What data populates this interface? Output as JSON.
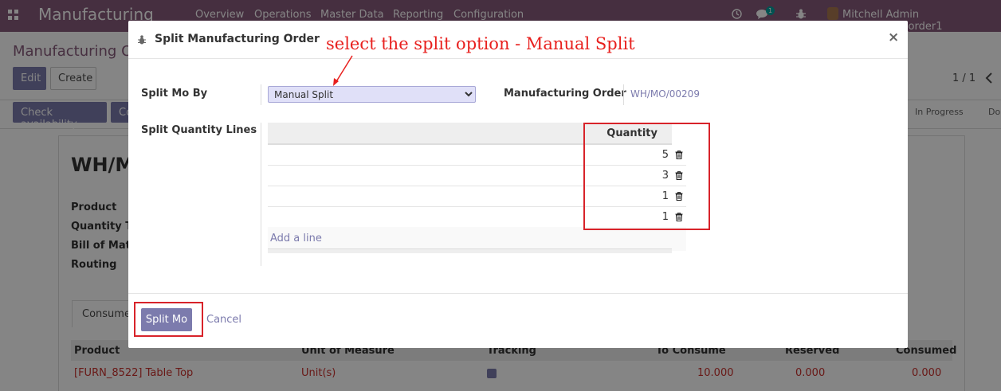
{
  "navbar": {
    "brand": "Manufacturing",
    "menu": [
      "Overview",
      "Operations",
      "Master Data",
      "Reporting",
      "Configuration"
    ],
    "chat_count": "1",
    "user": "Mitchell Admin (split_manu_order1"
  },
  "control_panel": {
    "breadcrumb": "Manufacturing Orc",
    "edit_label": "Edit",
    "create_label": "Create",
    "pager": "1 / 1",
    "check_availability": "Check availability",
    "second_button": "Co",
    "stages": [
      "In Progress",
      "Do"
    ]
  },
  "form": {
    "name": "WH/M",
    "labels": [
      "Product",
      "Quantity To",
      "Bill of Mater",
      "Routing"
    ],
    "tab_label": "Consumed",
    "table_headers": [
      "Product",
      "Unit of Measure",
      "Tracking",
      "To Consume",
      "Reserved",
      "Consumed"
    ],
    "row": {
      "product": "[FURN_8522] Table Top",
      "uom": "Unit(s)",
      "to_consume": "10.000",
      "reserved": "0.000",
      "consumed": "0.000"
    }
  },
  "modal": {
    "title": "Split Manufacturing Order",
    "split_by_label": "Split Mo By",
    "split_by_value": "Manual Split",
    "mo_label": "Manufacturing Order",
    "mo_value": "WH/MO/00209",
    "lines_label": "Split Quantity Lines",
    "quantity_header": "Quantity",
    "quantities": [
      "5",
      "3",
      "1",
      "1"
    ],
    "add_line": "Add a line",
    "split_button": "Split Mo",
    "cancel_button": "Cancel"
  },
  "annotation": {
    "text": "select the split option - Manual Split",
    "color": "#e8201e"
  },
  "colors": {
    "brand": "#875a7b",
    "primary": "#7c7bad",
    "annotation_red": "#d8232a"
  }
}
